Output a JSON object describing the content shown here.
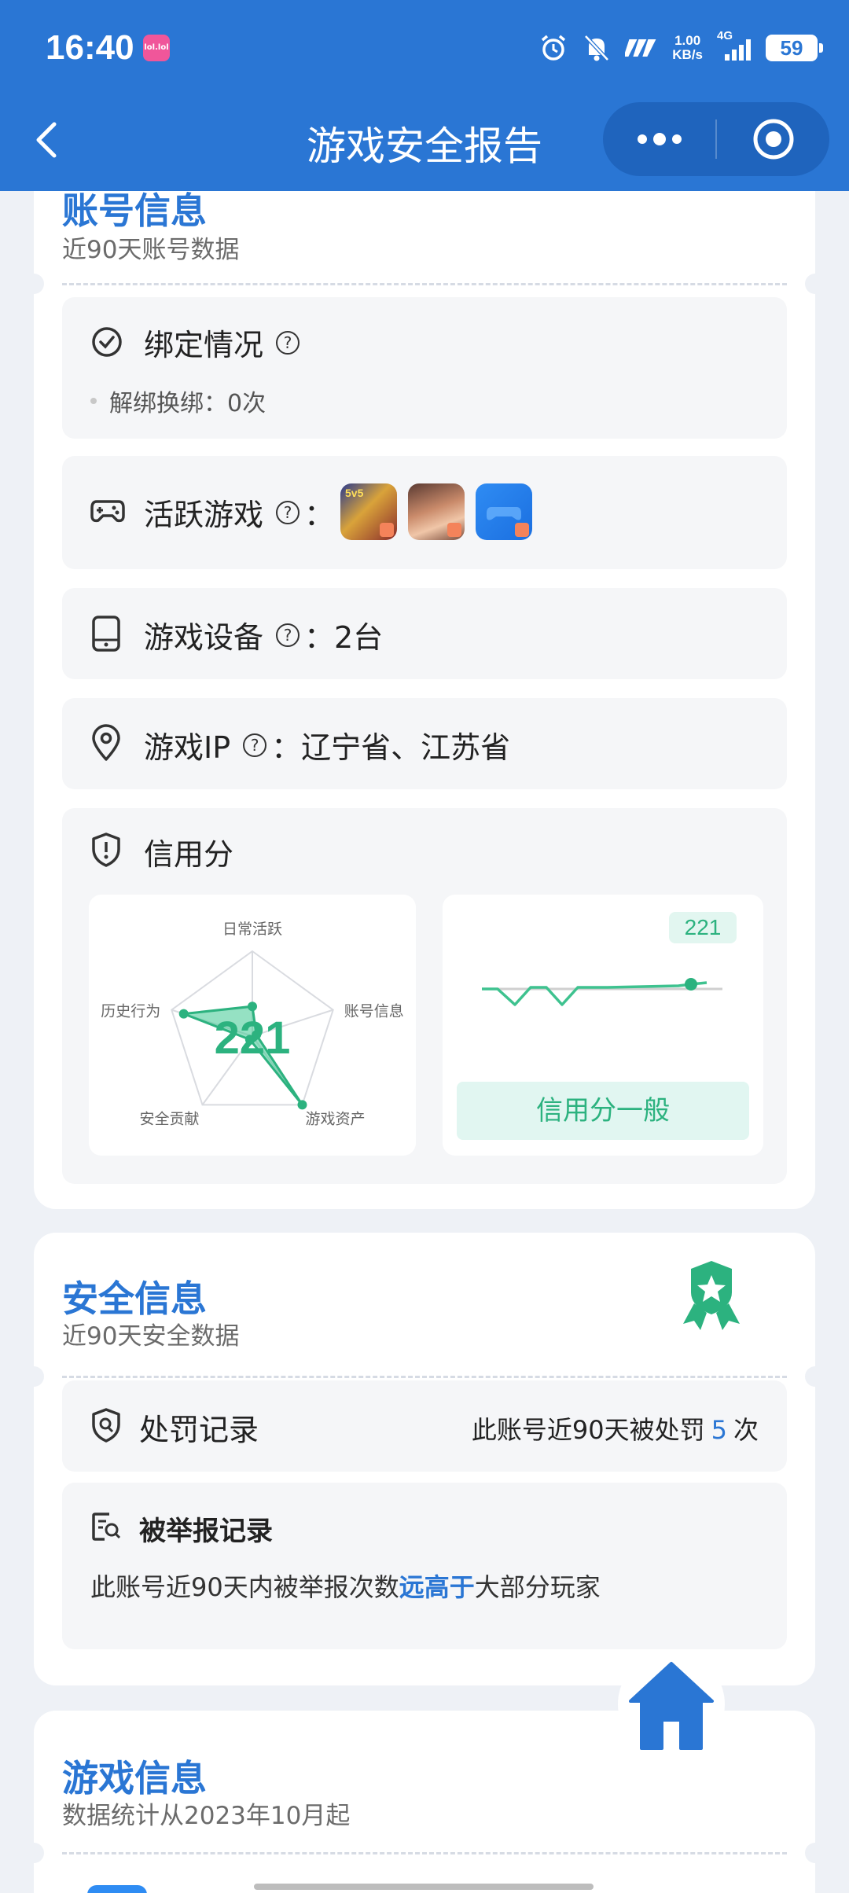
{
  "status_bar": {
    "time": "16:40",
    "app_icon_text": "lol.lol",
    "net_speed_value": "1.00",
    "net_speed_unit": "KB/s",
    "network": "4G",
    "battery": "59"
  },
  "title_bar": {
    "title": "游戏安全报告",
    "back_icon": "chevron-left-icon",
    "more_icon": "more-dots-icon",
    "close_icon": "target-circle-icon"
  },
  "account_section": {
    "title": "账号信息",
    "subtitle": "近90天账号数据",
    "binding": {
      "label": "绑定情况",
      "detail": "解绑换绑：0次"
    },
    "active_games": {
      "label": "活跃游戏",
      "suffix": "：",
      "games": [
        "王者荣耀",
        "游戏二",
        "游戏三"
      ]
    },
    "devices": {
      "label": "游戏设备",
      "value": "：2台"
    },
    "ip": {
      "label": "游戏IP",
      "value": "：辽宁省、江苏省"
    },
    "credit": {
      "label": "信用分",
      "score": "221",
      "status": "信用分一般",
      "radar_axes": [
        "日常活跃",
        "账号信息",
        "游戏资产",
        "安全贡献",
        "历史行为"
      ],
      "radar_values": [
        0.35,
        0.05,
        1.0,
        0.05,
        0.85
      ]
    }
  },
  "security_section": {
    "title": "安全信息",
    "subtitle": "近90天安全数据",
    "punish": {
      "label": "处罚记录",
      "text_before": "此账号近90天被处罚",
      "count": "5",
      "text_after": "次"
    },
    "report": {
      "label": "被举报记录",
      "text_before": "此账号近90天内被举报次数",
      "highlight": "远高于",
      "text_after": "大部分玩家"
    }
  },
  "game_section": {
    "title": "游戏信息",
    "subtitle": "数据统计从2023年10月起"
  },
  "colors": {
    "brand_blue": "#2a76d4",
    "credit_green": "#2cb27f"
  }
}
